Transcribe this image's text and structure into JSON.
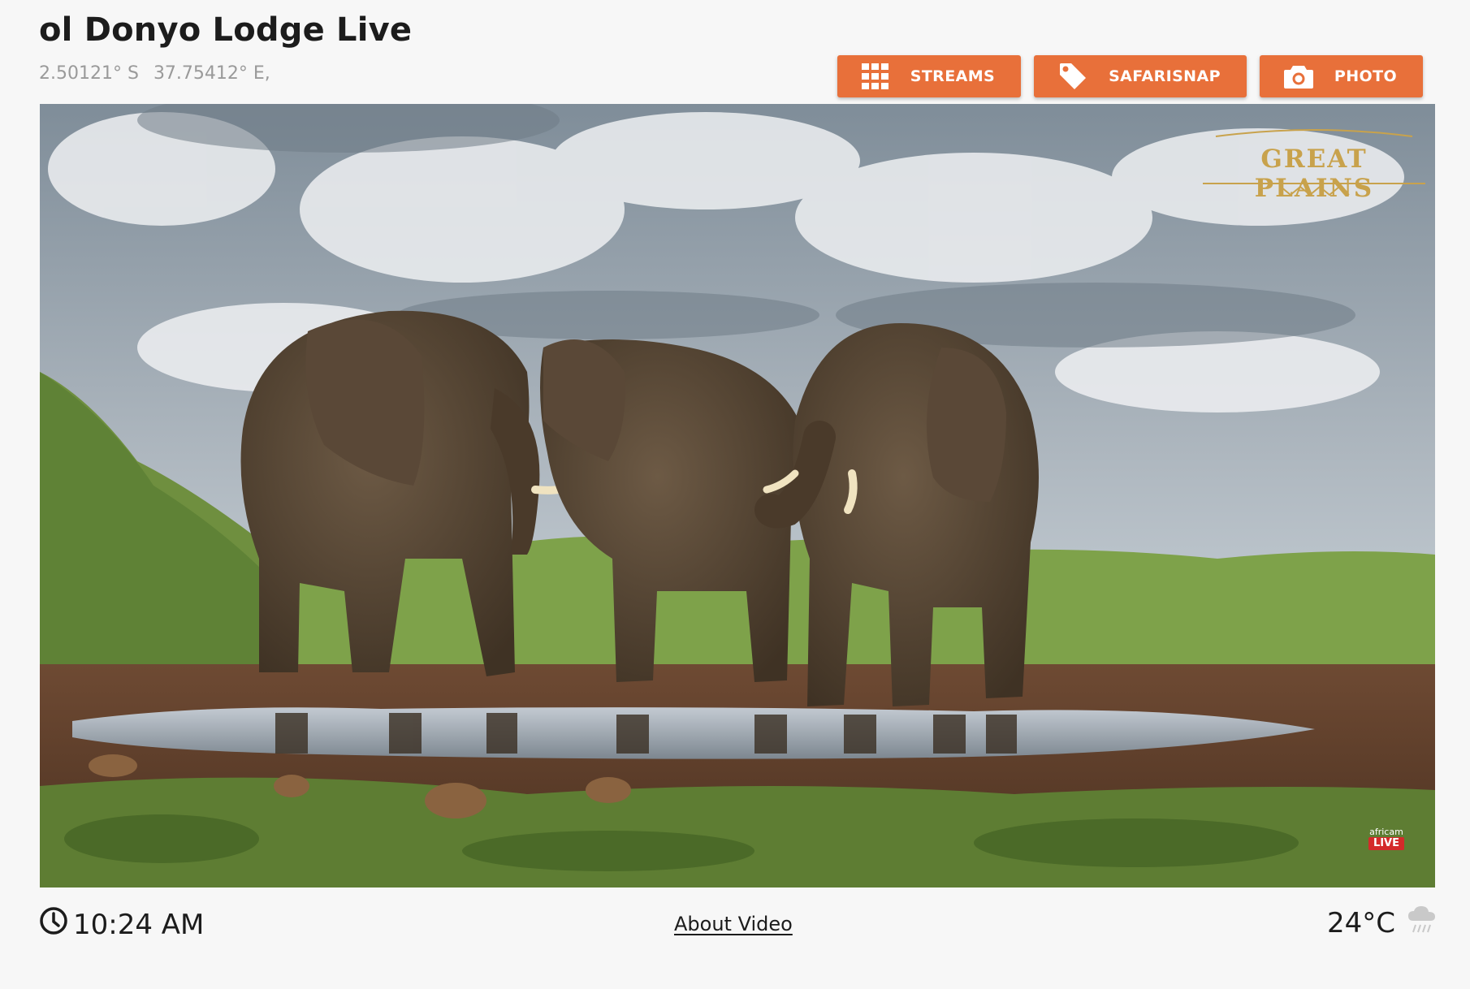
{
  "header": {
    "title": "ol Donyo Lodge Live",
    "latitude": "2.50121° S",
    "longitude": "37.75412° E,"
  },
  "buttons": [
    {
      "label": "STREAMS",
      "icon": "grid-icon"
    },
    {
      "label": "SAFARISNAP",
      "icon": "tag-icon"
    },
    {
      "label": "PHOTO",
      "icon": "camera-icon"
    }
  ],
  "video": {
    "watermark": "GREAT PLAINS",
    "badge_brand": "africam",
    "badge_live": "LIVE"
  },
  "footer": {
    "time": "10:24 AM",
    "about_label": "About Video",
    "temperature": "24°C",
    "weather_icon": "rain-cloud-icon"
  },
  "colors": {
    "accent": "#e8703a",
    "background": "#f7f7f7"
  }
}
